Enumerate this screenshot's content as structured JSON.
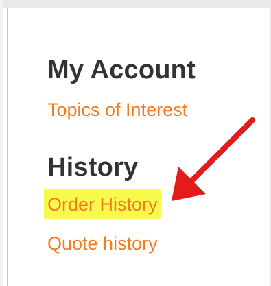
{
  "account_section": {
    "title": "My Account",
    "links": [
      "Topics of Interest"
    ]
  },
  "history_section": {
    "title": "History",
    "links": [
      "Order History",
      "Quote history"
    ]
  },
  "highlight": {
    "target": "Order History",
    "highlight_color": "#f8f94a",
    "arrow_color": "#e31b1b"
  },
  "colors": {
    "link": "#f47b20",
    "heading": "#333333"
  }
}
